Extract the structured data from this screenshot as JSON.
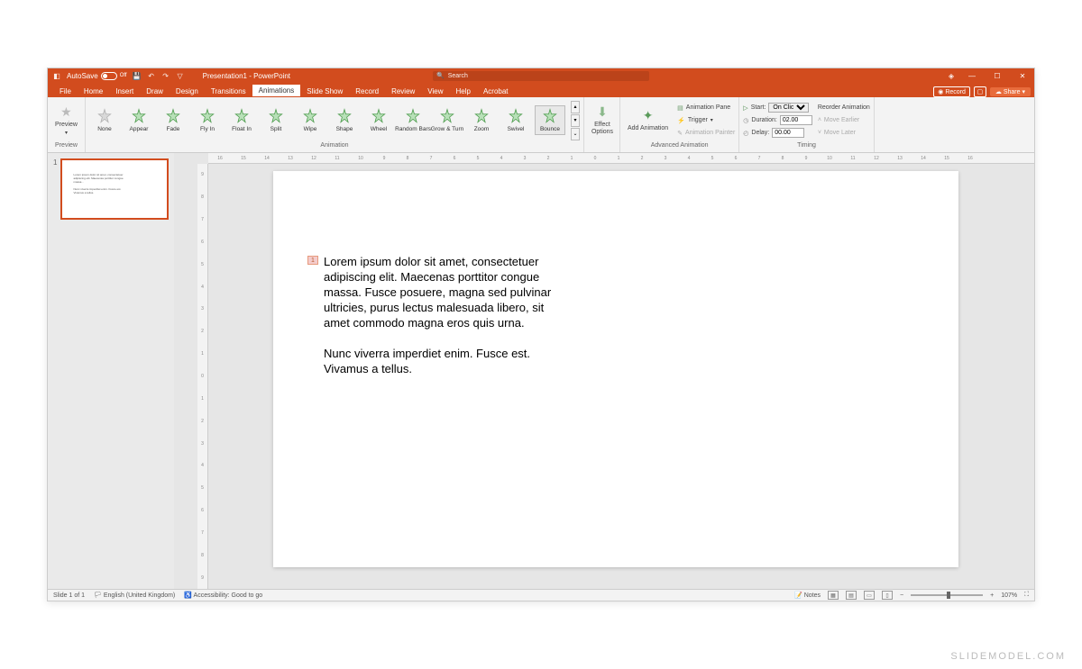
{
  "title_bar": {
    "autosave_label": "AutoSave",
    "autosave_state": "Off",
    "doc_title": "Presentation1 - PowerPoint",
    "search_placeholder": "Search"
  },
  "menu": {
    "items": [
      "File",
      "Home",
      "Insert",
      "Draw",
      "Design",
      "Transitions",
      "Animations",
      "Slide Show",
      "Record",
      "Review",
      "View",
      "Help",
      "Acrobat"
    ],
    "active": "Animations",
    "record": "Record",
    "share": "Share"
  },
  "ribbon": {
    "preview": {
      "label": "Preview",
      "group": "Preview"
    },
    "animations": {
      "items": [
        "None",
        "Appear",
        "Fade",
        "Fly In",
        "Float In",
        "Split",
        "Wipe",
        "Shape",
        "Wheel",
        "Random Bars",
        "Grow & Turn",
        "Zoom",
        "Swivel",
        "Bounce"
      ],
      "selected": "Bounce",
      "group": "Animation"
    },
    "effect_options": "Effect Options",
    "advanced": {
      "add": "Add Animation",
      "pane": "Animation Pane",
      "trigger": "Trigger",
      "painter": "Animation Painter",
      "group": "Advanced Animation"
    },
    "timing": {
      "start_label": "Start:",
      "start_value": "On Click",
      "duration_label": "Duration:",
      "duration_value": "02.00",
      "delay_label": "Delay:",
      "delay_value": "00.00",
      "group": "Timing"
    },
    "reorder": {
      "title": "Reorder Animation",
      "earlier": "Move Earlier",
      "later": "Move Later"
    }
  },
  "slide": {
    "anim_tag": "1",
    "paragraph1": "Lorem ipsum dolor sit amet, consectetuer adipiscing elit. Maecenas porttitor congue massa. Fusce posuere, magna sed pulvinar ultricies, purus lectus malesuada libero, sit amet commodo magna eros quis urna.",
    "paragraph2": "Nunc viverra imperdiet enim. Fusce est. Vivamus a tellus."
  },
  "status": {
    "slide": "Slide 1 of 1",
    "lang": "English (United Kingdom)",
    "access": "Accessibility: Good to go",
    "notes": "Notes",
    "zoom": "107%"
  },
  "watermark": "SLIDEMODEL.COM",
  "ruler_h": [
    "16",
    "15",
    "14",
    "13",
    "12",
    "11",
    "10",
    "9",
    "8",
    "7",
    "6",
    "5",
    "4",
    "3",
    "2",
    "1",
    "0",
    "1",
    "2",
    "3",
    "4",
    "5",
    "6",
    "7",
    "8",
    "9",
    "10",
    "11",
    "12",
    "13",
    "14",
    "15",
    "16"
  ],
  "ruler_v": [
    "9",
    "8",
    "7",
    "6",
    "5",
    "4",
    "3",
    "2",
    "1",
    "0",
    "1",
    "2",
    "3",
    "4",
    "5",
    "6",
    "7",
    "8",
    "9"
  ]
}
